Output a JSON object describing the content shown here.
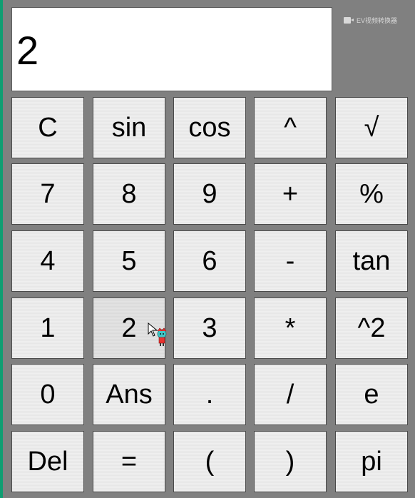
{
  "display": {
    "value": "2"
  },
  "watermark": {
    "icon": "video-camera-icon",
    "text": "EV视频转换器"
  },
  "keypad": {
    "rows": [
      [
        "C",
        "sin",
        "cos",
        "^",
        "√"
      ],
      [
        "7",
        "8",
        "9",
        "+",
        "%"
      ],
      [
        "4",
        "5",
        "6",
        "-",
        "tan"
      ],
      [
        "1",
        "2",
        "3",
        "*",
        "^2"
      ],
      [
        "0",
        "Ans",
        ".",
        "/",
        "e"
      ],
      [
        "Del",
        "=",
        "(",
        ")",
        "pi"
      ]
    ]
  },
  "colors": {
    "window_bg": "#808080",
    "button_bg": "#efefef",
    "button_hover_bg": "#e3e3e3",
    "desktop_edge": "#0f9e72"
  },
  "cursor": {
    "icon": "pointer-cursor-icon",
    "over_key": "2"
  }
}
